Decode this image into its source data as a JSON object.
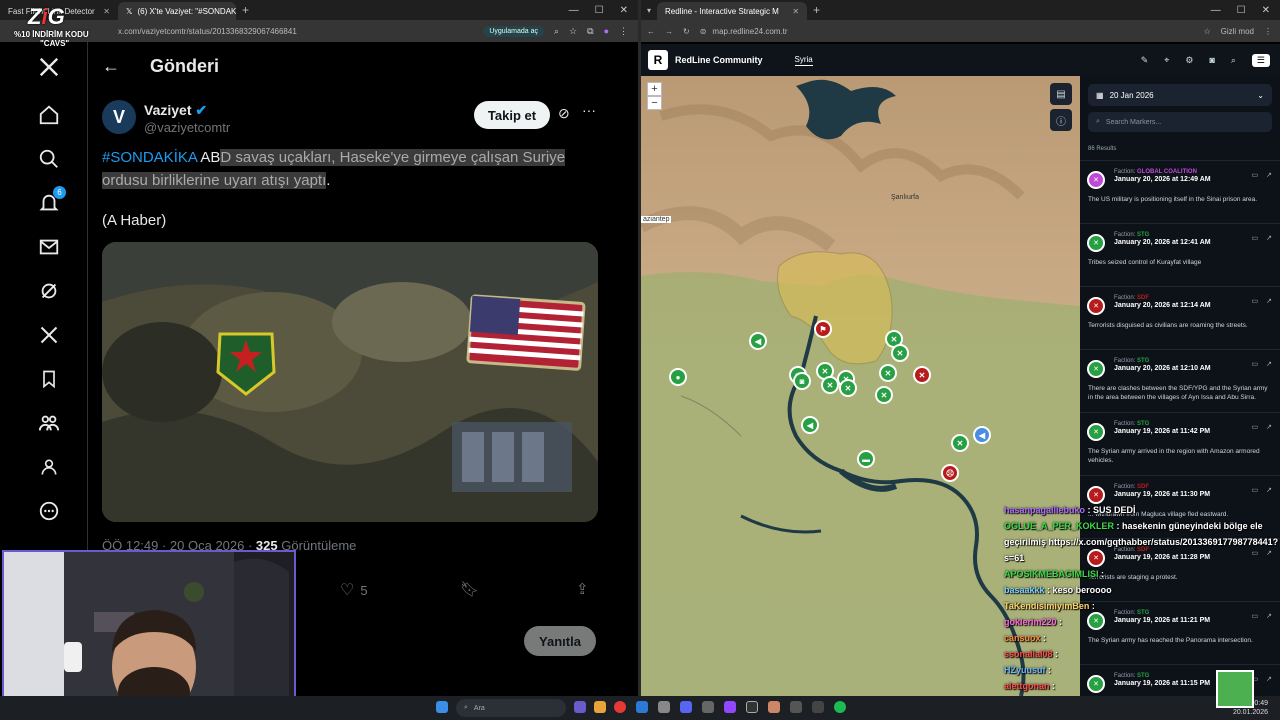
{
  "left_browser": {
    "tabs": [
      {
        "label": "Fast Flight Link Detector"
      },
      {
        "label": "(6) X'te Vaziyet: \"#SONDAKİKA"
      }
    ],
    "url": "x.com/vaziyetcomtr/status/2013368329067466841",
    "app_pill": "Uygulamada aç"
  },
  "stream_overlay": {
    "promo_line1": "%10 İNDİRİM KODU",
    "promo_line2": "\"CAVS\""
  },
  "x_sidebar": {
    "notifications_badge": "6"
  },
  "post": {
    "header_title": "Gönderi",
    "author_name": "Vaziyet",
    "author_handle": "@vaziyetcomtr",
    "follow_label": "Takip et",
    "hashtag": "#SONDAKİKA",
    "text_plain": " AB",
    "text_selected": "D savaş uçakları, Haseke'ye girmeye çalışan Suriye ordusu birliklerine uyarı atışı yaptı",
    "text_end": ".",
    "source": "(A Haber)",
    "timestamp": "ÖÖ 12:49 · 20 Oca 2026 · ",
    "views_count": "325",
    "views_label": " Görüntüleme",
    "likes": "5",
    "reply_label": "Yanıtla"
  },
  "right_browser": {
    "tab_label": "Redline - Interactive Strategic M",
    "url": "map.redline24.com.tr",
    "private_label": "Gizli mod"
  },
  "redline": {
    "brand": "RedLine Community",
    "region_tab": "Syria",
    "date": "20 Jan 2026",
    "search_placeholder": "Search Markers...",
    "results": "86 Results",
    "city_labels": [
      "Şanlıurfa",
      "aziantep"
    ],
    "feed": [
      {
        "faction": "GLOBAL COALITION",
        "color": "#c04ad8",
        "date": "January 20, 2026 at 12:49 AM",
        "text": "The US military is positioning itself in the Sinai prison area."
      },
      {
        "faction": "STG",
        "color": "#27a044",
        "date": "January 20, 2026 at 12:41 AM",
        "text": "Tribes seized control of Kurayfat village"
      },
      {
        "faction": "SDF",
        "color": "#b71c1c",
        "date": "January 20, 2026 at 12:14 AM",
        "text": "Terrorists disguised as civilians are roaming the streets."
      },
      {
        "faction": "STG",
        "color": "#27a044",
        "date": "January 20, 2026 at 12:10 AM",
        "text": "There are clashes between the SDF/YPG and the Syrian army in the area between the villages of Ayn Issa and Abu Sirra."
      },
      {
        "faction": "STG",
        "color": "#27a044",
        "date": "January 19, 2026 at 11:42 PM",
        "text": "The Syrian army arrived in the region with Amazon armored vehicles."
      },
      {
        "faction": "SDF",
        "color": "#b71c1c",
        "date": "January 19, 2026 at 11:30 PM",
        "text": "... withdrawn from Magluca village fled eastward."
      },
      {
        "faction": "SDF",
        "color": "#b71c1c",
        "date": "January 19, 2026 at 11:28 PM",
        "text": "Terrorists are staging a protest."
      },
      {
        "faction": "STG",
        "color": "#27a044",
        "date": "January 19, 2026 at 11:21 PM",
        "text": "The Syrian army has reached the Panorama intersection."
      },
      {
        "faction": "STG",
        "color": "#27a044",
        "date": "January 19, 2026 at 11:15 PM",
        "text": "The Syrian army is reportedly close to the ... junction south of Hasakah."
      }
    ]
  },
  "chat": [
    {
      "user": "hasanpagalliebuko",
      "msg": ": SUS DEDİ",
      "color": "#b06cff"
    },
    {
      "user": "OGLUE_A_PER_KOKLER",
      "msg": ": hasekenin güneyindeki bölge ele geçirilmiş https://x.com/gqthabber/status/201336917798778441?s=61",
      "color": "#3ddc4a"
    },
    {
      "user": "APOSIKMEBAGIMLISI",
      "msg": ":",
      "color": "#3ddc4a"
    },
    {
      "user": "basaakkk",
      "msg": ": keso beroooo",
      "color": "#7fd1ff"
    },
    {
      "user": "TaKendisimiyimBen",
      "msg": ":",
      "color": "#ffd36b"
    },
    {
      "user": "goklerim220",
      "msg": ":",
      "color": "#ff6bd8"
    },
    {
      "user": "cansuox",
      "msg": ":",
      "color": "#ff8a3d"
    },
    {
      "user": "ssonallal08",
      "msg": ":",
      "color": "#ff4f4f"
    },
    {
      "user": "HZyuusuf",
      "msg": ":",
      "color": "#6bb7ff"
    },
    {
      "user": "alettgonan",
      "msg": ":",
      "color": "#ff4f4f"
    }
  ],
  "taskbar": {
    "search_placeholder": "Ara",
    "time": "00:49",
    "date": "20.01.2026"
  },
  "colors": {
    "x_blue": "#1d9bf0",
    "redline_green": "#27a044",
    "redline_red": "#b71c1c"
  }
}
